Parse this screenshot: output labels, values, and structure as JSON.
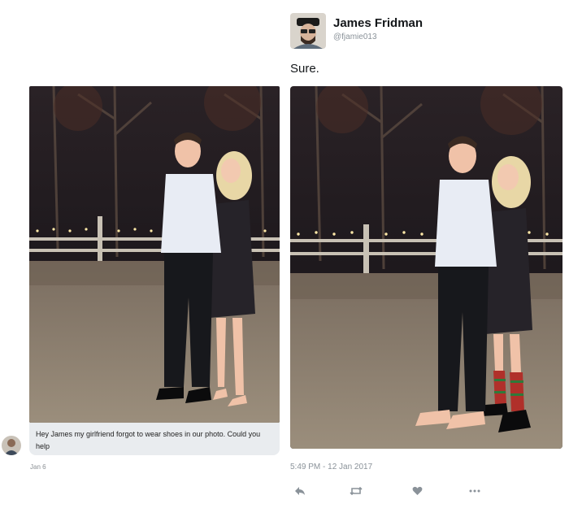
{
  "tweet": {
    "display_name": "James Fridman",
    "handle": "@fjamie013",
    "text": "Sure.",
    "timestamp": "5:49 PM - 12 Jan 2017",
    "actions": [
      {
        "icon": "reply-icon"
      },
      {
        "icon": "retweet-icon"
      },
      {
        "icon": "like-heart-icon"
      },
      {
        "icon": "more-options-icon"
      }
    ]
  },
  "request": {
    "message_text": "Hey James my girlfriend forgot to wear shoes in our photo. Could you help",
    "date": "Jan 6"
  },
  "colors": {
    "background": "#ffffff",
    "bubble": "#e9ecef",
    "muted_text": "#8a9299",
    "night_sky": "#1c1a1e",
    "gravel": "#8f8373"
  }
}
